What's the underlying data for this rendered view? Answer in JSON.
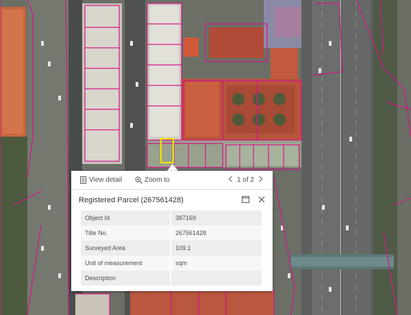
{
  "map": {
    "highlight_color": "#f2e600",
    "boundary_color": "#d6158a"
  },
  "popup": {
    "actions": {
      "view_detail_label": "View detail",
      "view_detail_icon": "document-icon",
      "zoom_to_label": "Zoom to",
      "zoom_to_icon": "zoom-in-icon"
    },
    "pager": {
      "text": "1 of 2",
      "prev_icon": "chevron-left-icon",
      "next_icon": "chevron-right-icon"
    },
    "title": "Registered Parcel (267561428)",
    "controls": {
      "dock_icon": "dock-icon",
      "close_icon": "close-icon"
    },
    "attributes": [
      {
        "field": "Object Id",
        "value": "387169"
      },
      {
        "field": "Title No.",
        "value": "267561428"
      },
      {
        "field": "Surveyed Area",
        "value": "109.1"
      },
      {
        "field": "Unit of measurement",
        "value": "sqm"
      },
      {
        "field": "Description",
        "value": ""
      }
    ]
  }
}
